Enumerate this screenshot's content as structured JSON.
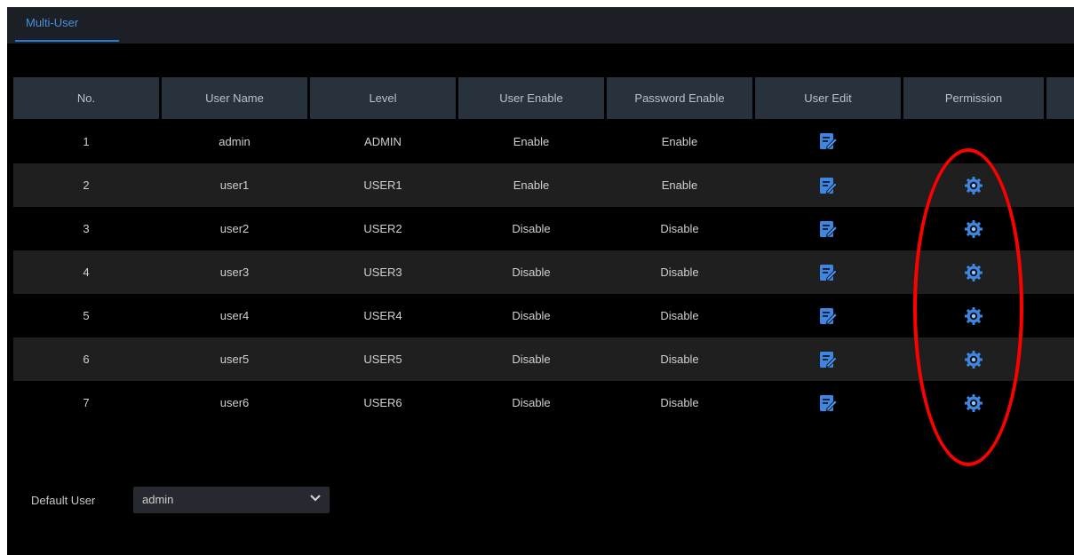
{
  "tabs": [
    {
      "label": "Multi-User"
    }
  ],
  "table": {
    "headers": [
      "No.",
      "User Name",
      "Level",
      "User Enable",
      "Password Enable",
      "User Edit",
      "Permission",
      ""
    ],
    "rows": [
      {
        "no": "1",
        "user": "admin",
        "level": "ADMIN",
        "user_enable": "Enable",
        "password_enable": "Enable",
        "has_permission": false
      },
      {
        "no": "2",
        "user": "user1",
        "level": "USER1",
        "user_enable": "Enable",
        "password_enable": "Enable",
        "has_permission": true
      },
      {
        "no": "3",
        "user": "user2",
        "level": "USER2",
        "user_enable": "Disable",
        "password_enable": "Disable",
        "has_permission": true
      },
      {
        "no": "4",
        "user": "user3",
        "level": "USER3",
        "user_enable": "Disable",
        "password_enable": "Disable",
        "has_permission": true
      },
      {
        "no": "5",
        "user": "user4",
        "level": "USER4",
        "user_enable": "Disable",
        "password_enable": "Disable",
        "has_permission": true
      },
      {
        "no": "6",
        "user": "user5",
        "level": "USER5",
        "user_enable": "Disable",
        "password_enable": "Disable",
        "has_permission": true
      },
      {
        "no": "7",
        "user": "user6",
        "level": "USER6",
        "user_enable": "Disable",
        "password_enable": "Disable",
        "has_permission": true
      }
    ]
  },
  "default_user": {
    "label": "Default User",
    "value": "admin"
  },
  "icons": {
    "edit": "edit-icon",
    "permission": "gear-icon",
    "dropdown": "chevron-down-icon"
  },
  "colors": {
    "accent": "#2a78d6",
    "icon_blue": "#3f86e0",
    "annotation": "#ff0000"
  }
}
